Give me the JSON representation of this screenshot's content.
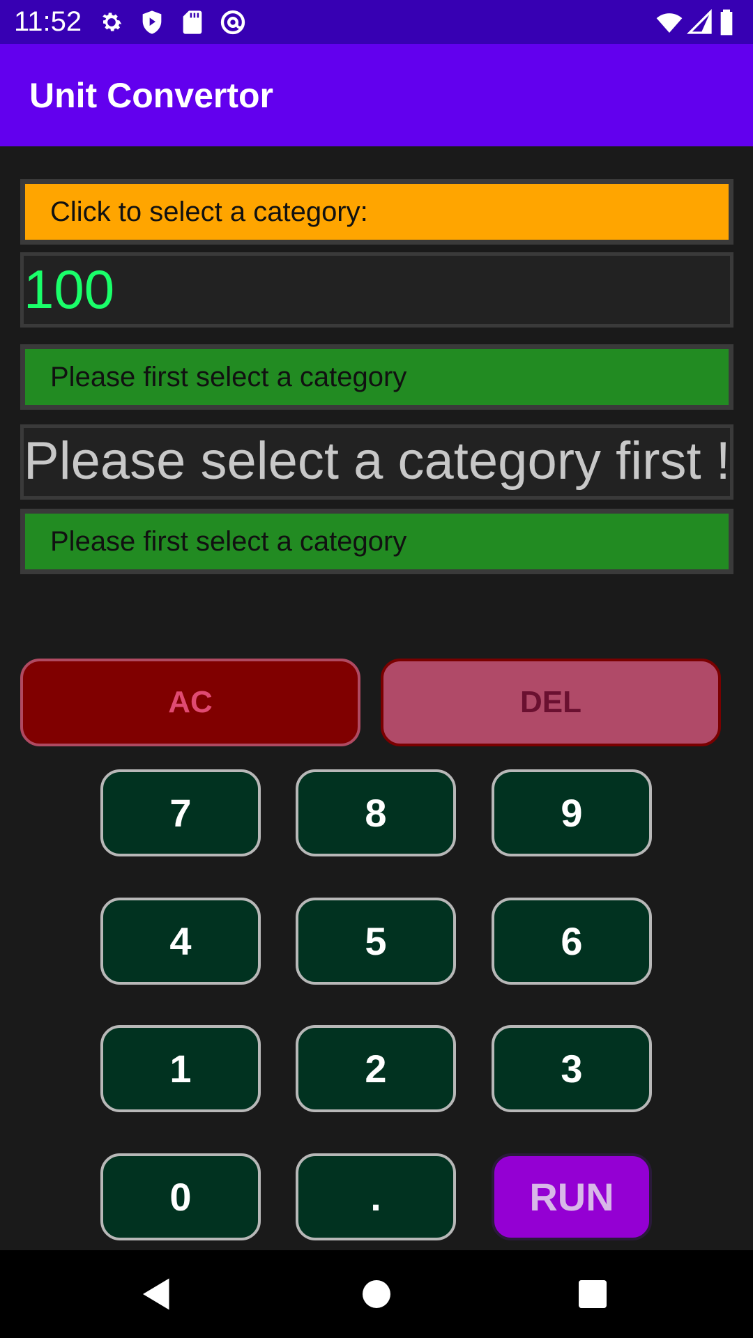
{
  "status_bar": {
    "time": "11:52",
    "icons": [
      "gear-icon",
      "shield-play-icon",
      "sd-card-icon",
      "at-sign-icon",
      "wifi-icon",
      "signal-icon",
      "battery-icon"
    ]
  },
  "app_bar": {
    "title": "Unit Convertor"
  },
  "category_select": {
    "label": "Click to select a category:",
    "color": "#ffa500"
  },
  "value_input": {
    "value": "100",
    "color": "#1aff6a"
  },
  "from_unit": {
    "label": "Please first select a category",
    "color": "#228b22"
  },
  "result": {
    "text": "Please select a category first !"
  },
  "to_unit": {
    "label": "Please first select a category",
    "color": "#228b22"
  },
  "buttons": {
    "ac": "AC",
    "del": "DEL",
    "keys": [
      "7",
      "8",
      "9",
      "4",
      "5",
      "6",
      "1",
      "2",
      "3",
      "0",
      "."
    ],
    "run": "RUN"
  },
  "colors": {
    "status_bar": "#3700b3",
    "app_bar": "#6200ee",
    "background": "#1a1a1a",
    "key_bg": "#013220",
    "run_bg": "#9400d3",
    "ac_bg": "#800000",
    "del_bg": "#b04a68"
  }
}
